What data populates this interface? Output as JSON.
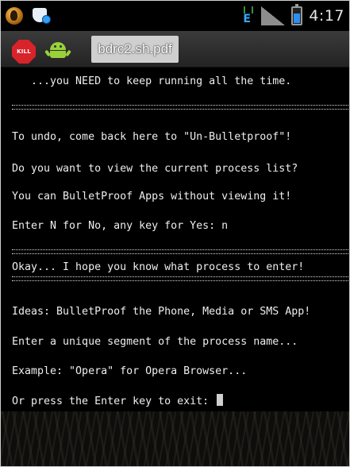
{
  "status_bar": {
    "left_icons": [
      "mask-icon",
      "shield-icon"
    ],
    "right_icons": [
      "network-e-icon",
      "signal-icon",
      "battery-icon"
    ],
    "network_letter": "E",
    "time": "4:17"
  },
  "title_bar": {
    "kill_button_label": "KILL",
    "title": "bdrc2.sh.pdf"
  },
  "terminal": {
    "lines": [
      "   ...you NEED to keep running all the time.",
      "To undo, come back here to \"Un-Bulletproof\"!",
      "Do you want to view the current process list?",
      "You can BulletProof Apps without viewing it!",
      "Enter N for No, any key for Yes: n",
      "Okay... I hope you know what process to enter!",
      "Ideas: BulletProof the Phone, Media or SMS App!",
      "Enter a unique segment of the process name...",
      "Example: \"Opera\" for Opera Browser...",
      "Or press the Enter key to exit: "
    ]
  },
  "colors": {
    "terminal_bg": "#000000",
    "terminal_text": "#eeeeee",
    "title_bar_bg": "#2e2e2e",
    "title_tab_bg": "#cfcfcf",
    "kill_red": "#d8232a",
    "android_green": "#9ad13a"
  }
}
